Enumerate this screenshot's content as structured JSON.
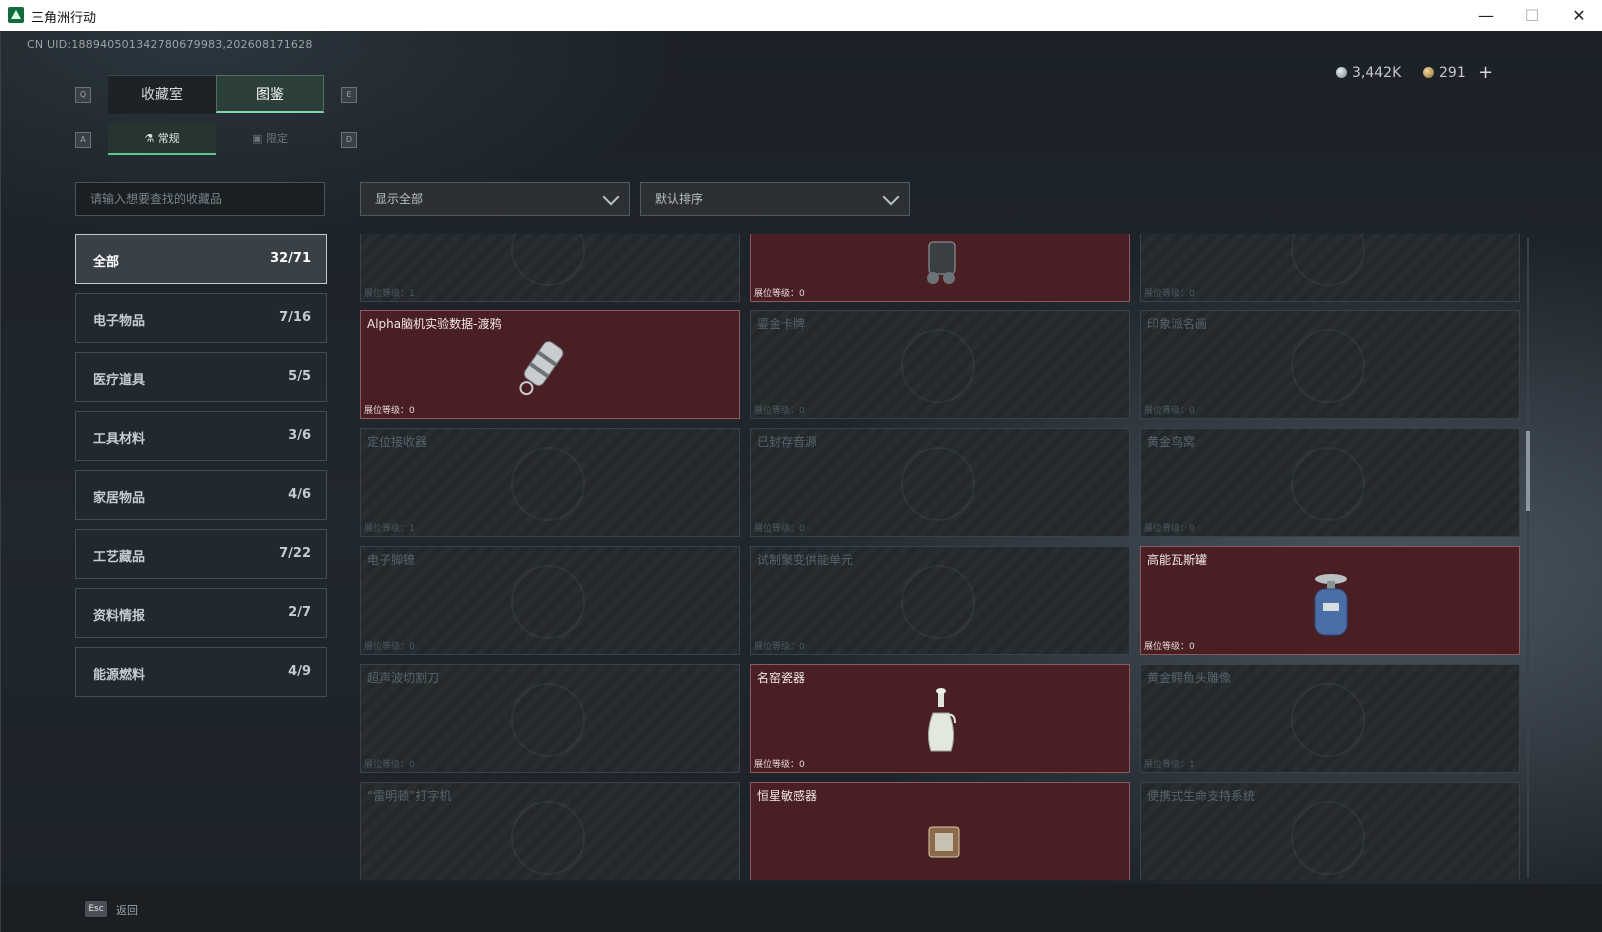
{
  "window": {
    "title": "三角洲行动",
    "minimize": "—",
    "maximize": "☐",
    "close": "✕"
  },
  "uid": "CN UID:18894050134278067998​3,202608171628",
  "currency": {
    "silver": "3,442K",
    "gold": "291",
    "plus": "+"
  },
  "tabs": {
    "key_left": "Q",
    "key_right": "E",
    "collection": "收藏室",
    "handbook": "图鉴"
  },
  "subtabs": {
    "key_left": "A",
    "key_right": "D",
    "regular": "常规",
    "limited": "限定"
  },
  "search": {
    "placeholder": "请输入想要查找的收藏品"
  },
  "filters": {
    "show": "显示全部",
    "sort": "默认排序"
  },
  "categories": [
    {
      "label": "全部",
      "count": "32/71"
    },
    {
      "label": "电子物品",
      "count": "7/16"
    },
    {
      "label": "医疗道具",
      "count": "5/5"
    },
    {
      "label": "工具材料",
      "count": "3/6"
    },
    {
      "label": "家居物品",
      "count": "4/6"
    },
    {
      "label": "工艺藏品",
      "count": "7/22"
    },
    {
      "label": "资料情报",
      "count": "2/7"
    },
    {
      "label": "能源燃料",
      "count": "4/9"
    }
  ],
  "items": [
    {
      "name": "",
      "level": "展位等级：1",
      "owned": false
    },
    {
      "name": "",
      "level": "展位等级：0",
      "owned": true
    },
    {
      "name": "",
      "level": "展位等级：0",
      "owned": false
    },
    {
      "name": "Alpha脑机实验数据-渡鸦",
      "level": "展位等级：0",
      "owned": true
    },
    {
      "name": "鎏金卡牌",
      "level": "展位等级：0",
      "owned": false
    },
    {
      "name": "印象派名画",
      "level": "展位等级：0",
      "owned": false
    },
    {
      "name": "定位接收器",
      "level": "展位等级：1",
      "owned": false
    },
    {
      "name": "已封存音源",
      "level": "展位等级：0",
      "owned": false
    },
    {
      "name": "黄金鸟窝",
      "level": "展位等级：0",
      "owned": false
    },
    {
      "name": "电子脚镣",
      "level": "展位等级：0",
      "owned": false
    },
    {
      "name": "试制聚变供能单元",
      "level": "展位等级：0",
      "owned": false
    },
    {
      "name": "高能瓦斯罐",
      "level": "展位等级：0",
      "owned": true
    },
    {
      "name": "超声波切割刀",
      "level": "展位等级：0",
      "owned": false
    },
    {
      "name": "名窑瓷器",
      "level": "展位等级：0",
      "owned": true
    },
    {
      "name": "黄金鳄鱼头雕像",
      "level": "展位等级：1",
      "owned": false
    },
    {
      "name": "“雷明顿”打字机",
      "level": "",
      "owned": false
    },
    {
      "name": "恒星敏感器",
      "level": "",
      "owned": true
    },
    {
      "name": "便携式生命支持系统",
      "level": "",
      "owned": false
    }
  ],
  "footer": {
    "key": "Esc",
    "label": "返回"
  },
  "colors": {
    "owned_bg": "#4a1f23",
    "accent_green": "#7fd8a8",
    "panel_bg": "#22282c"
  }
}
